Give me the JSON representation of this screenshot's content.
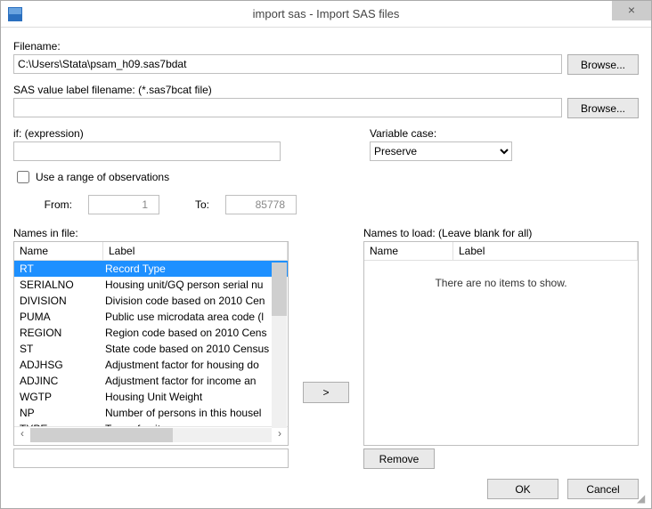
{
  "title": "import sas - Import SAS files",
  "labels": {
    "filename": "Filename:",
    "browse": "Browse...",
    "sas_value": "SAS value label filename: (*.sas7bcat file)",
    "if_expr": "if: (expression)",
    "var_case": "Variable case:",
    "use_range": "Use a range of observations",
    "from": "From:",
    "to": "To:",
    "names_in_file": "Names in file:",
    "names_to_load": "Names to load: (Leave blank for all)",
    "col_name": "Name",
    "col_label": "Label",
    "empty": "There are no items to show.",
    "remove": "Remove",
    "ok": "OK",
    "cancel": "Cancel",
    "move": ">"
  },
  "values": {
    "filename": "C:\\Users\\Stata\\psam_h09.sas7bdat",
    "sas_value": "",
    "if_expr": "",
    "var_case": "Preserve",
    "from": "1",
    "to": "85778",
    "filter": ""
  },
  "names_table": [
    {
      "name": "RT",
      "label": "Record Type",
      "selected": true
    },
    {
      "name": "SERIALNO",
      "label": "Housing unit/GQ person serial nu"
    },
    {
      "name": "DIVISION",
      "label": "Division code based on 2010 Cen"
    },
    {
      "name": "PUMA",
      "label": "Public use microdata area code (l"
    },
    {
      "name": "REGION",
      "label": "Region code based on 2010 Cens"
    },
    {
      "name": "ST",
      "label": "State code based on 2010 Census"
    },
    {
      "name": "ADJHSG",
      "label": "Adjustment factor for housing do"
    },
    {
      "name": "ADJINC",
      "label": "Adjustment factor for income an"
    },
    {
      "name": "WGTP",
      "label": "Housing Unit Weight"
    },
    {
      "name": "NP",
      "label": "Number of persons in this housel"
    },
    {
      "name": "TYPE",
      "label": "Type of unit"
    }
  ]
}
